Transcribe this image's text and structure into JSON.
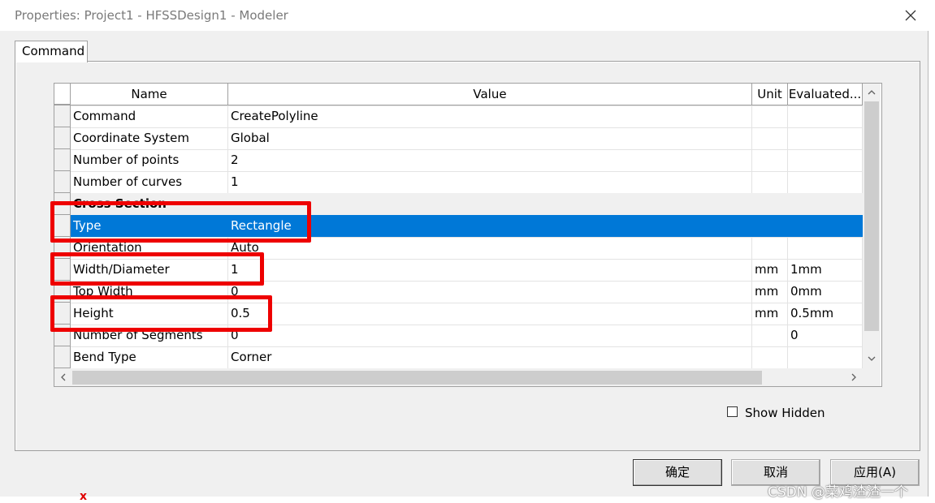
{
  "window": {
    "title": "Properties: Project1 - HFSSDesign1 - Modeler"
  },
  "tabs": [
    {
      "label": "Command"
    }
  ],
  "grid": {
    "columns": {
      "name": "Name",
      "value": "Value",
      "unit": "Unit",
      "evaluated": "Evaluated..."
    },
    "rows": [
      {
        "name": "Command",
        "value": "CreatePolyline",
        "unit": "",
        "evaluated": ""
      },
      {
        "name": "Coordinate System",
        "value": "Global",
        "unit": "",
        "evaluated": ""
      },
      {
        "name": "Number of points",
        "value": "2",
        "unit": "",
        "evaluated": ""
      },
      {
        "name": "Number of curves",
        "value": "1",
        "unit": "",
        "evaluated": ""
      },
      {
        "section": "Cross Section"
      },
      {
        "name": "Type",
        "value": "Rectangle",
        "unit": "",
        "evaluated": "",
        "selected": true
      },
      {
        "name": "Orientation",
        "value": "Auto",
        "unit": "",
        "evaluated": ""
      },
      {
        "name": "Width/Diameter",
        "value": "1",
        "unit": "mm",
        "evaluated": "1mm"
      },
      {
        "name": "Top Width",
        "value": "0",
        "unit": "mm",
        "evaluated": "0mm"
      },
      {
        "name": "Height",
        "value": "0.5",
        "unit": "mm",
        "evaluated": "0.5mm"
      },
      {
        "name": "Number of Segments",
        "value": "0",
        "unit": "",
        "evaluated": "0"
      },
      {
        "name": "Bend Type",
        "value": "Corner",
        "unit": "",
        "evaluated": ""
      }
    ]
  },
  "options": {
    "show_hidden_label": "Show Hidden",
    "show_hidden_checked": false
  },
  "buttons": {
    "ok": "确定",
    "cancel": "取消",
    "apply": "应用(A)"
  },
  "background": {
    "marker": "x"
  },
  "watermark": "CSDN @菜鸡渣渣一个",
  "colors": {
    "selection": "#0078d7",
    "highlight": "#ee0000"
  }
}
